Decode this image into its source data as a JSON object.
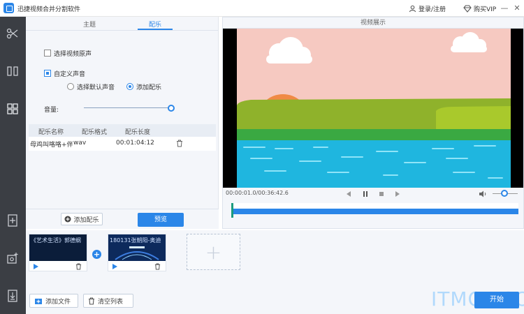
{
  "app": {
    "title": "迅捷视频合并分割软件"
  },
  "titlebar": {
    "login": "登录/注册",
    "vip": "购买VIP",
    "minimize": "—",
    "close": "✕"
  },
  "sidebar": {
    "items": [
      "cut-tool",
      "split-tool",
      "merge-tool",
      "add-file",
      "add-media",
      "export"
    ]
  },
  "tabs": [
    {
      "label": "主题"
    },
    {
      "label": "配乐",
      "active": true
    }
  ],
  "music": {
    "original_sound": {
      "label": "选择视频原声",
      "checked": false
    },
    "custom_sound": {
      "label": "自定义声音",
      "checked": true
    },
    "default_sound": {
      "label": "选择默认声音",
      "checked": false
    },
    "add_music_radio": {
      "label": "添加配乐",
      "checked": true
    },
    "volume_label": "音量:",
    "volume_level": 1.0,
    "table": {
      "headers": [
        "配乐名称",
        "配乐格式",
        "配乐长度"
      ],
      "rows": [
        {
          "name": "母鸡叫咯咯+伴",
          "format": "wav",
          "length": "00:01:04:12"
        }
      ]
    },
    "add_button": "添加配乐",
    "preview_button": "预览"
  },
  "display": {
    "title": "视频展示",
    "timecode": "00:00:01.0/00:36:42.6",
    "volume_level": 0.4,
    "progress": 0.0
  },
  "clips": [
    {
      "title": "《艺术生活》郭德纲"
    },
    {
      "title": "180131张朝阳-奥迪"
    }
  ],
  "bottom": {
    "add_file": "添加文件",
    "clear_list": "清空列表",
    "start": "开始"
  },
  "watermark": "ITMOP.COM",
  "colors": {
    "accent": "#2b86e8",
    "sidebar": "#3b3e44",
    "panel": "#f4f6fa"
  }
}
